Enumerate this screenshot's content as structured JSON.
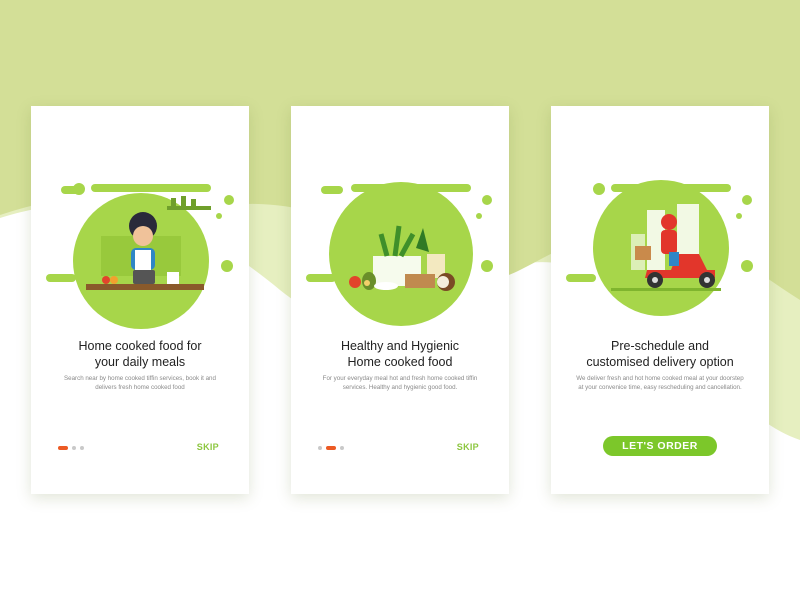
{
  "cards": [
    {
      "title": "Home cooked food for\nyour daily meals",
      "description": "Search near by home cooked tiffin services, book it and delivers fresh home cooked food",
      "skip_label": "SKIP",
      "active_page": 1,
      "page_count": 3
    },
    {
      "title": "Healthy and Hygienic\nHome cooked food",
      "description": "For your everyday meal hot and fresh home cooked tiffin services. Healthy and hygienic good food.",
      "skip_label": "SKIP",
      "active_page": 2,
      "page_count": 3
    },
    {
      "title": "Pre-schedule and\ncustomised delivery option",
      "description": "We deliver fresh and hot home cooked meal at your doorstep at your convenice time, easy rescheduling and cancellation.",
      "button_label": "LET'S ORDER"
    }
  ],
  "colors": {
    "background_top": "#d3df97",
    "background_wave": "#e6efc0",
    "accent_green": "#8cc63f",
    "button_green": "#7cc72a",
    "dot_active": "#ec5a24",
    "dot_inactive": "#c9c9c9"
  },
  "illustrations": [
    "chef-cooking-illustration",
    "vegetables-illustration",
    "scooter-delivery-illustration"
  ]
}
